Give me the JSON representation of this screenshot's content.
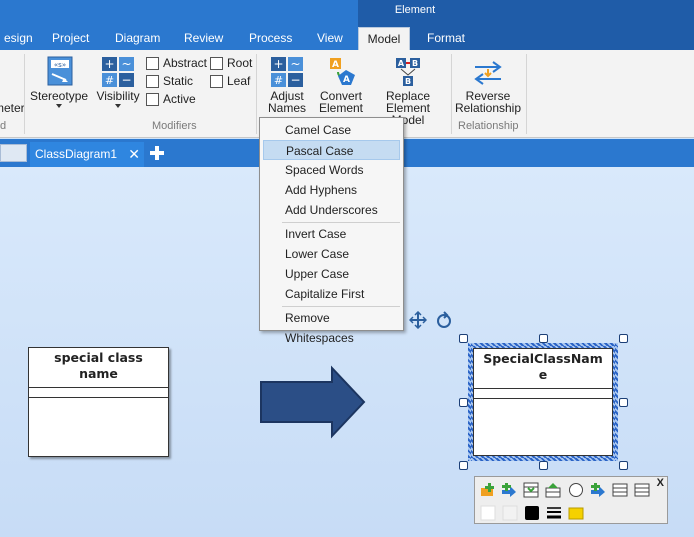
{
  "ribbon": {
    "context_title": "Element",
    "tabs": [
      {
        "label": "esign"
      },
      {
        "label": "Project"
      },
      {
        "label": "Diagram"
      },
      {
        "label": "Review"
      },
      {
        "label": "Process"
      },
      {
        "label": "View"
      },
      {
        "label": "Model"
      },
      {
        "label": "Format"
      }
    ],
    "active_tab": "Model",
    "left_cut_button": "meter",
    "left_cut_group": "d",
    "stereotype": {
      "label": "Stereotype"
    },
    "visibility": {
      "label": "Visibility"
    },
    "checkboxes": {
      "abstract": "Abstract",
      "static": "Static",
      "active": "Active",
      "root": "Root",
      "leaf": "Leaf"
    },
    "modifiers_group": "Modifiers",
    "adjust_names": {
      "line1": "Adjust",
      "line2": "Names"
    },
    "convert_element": {
      "line1": "Convert",
      "line2": "Element"
    },
    "replace_element": {
      "line1": "Replace",
      "line2": "Element Model"
    },
    "reverse_relationship": {
      "line1": "Reverse",
      "line2": "Relationship"
    },
    "relationship_group": "Relationship"
  },
  "doc_tabs": {
    "active": "ClassDiagram1",
    "close": "✕"
  },
  "menu": {
    "items_group1": [
      "Camel Case",
      "Pascal Case",
      "Spaced Words",
      "Add Hyphens",
      "Add Underscores"
    ],
    "items_group2": [
      "Invert Case",
      "Lower Case",
      "Upper Case",
      "Capitalize First"
    ],
    "items_group3": [
      "Remove Whitespaces"
    ],
    "highlighted": "Pascal Case"
  },
  "diagram": {
    "left_class": {
      "line1": "special class",
      "line2": "name"
    },
    "right_class": {
      "line1": "SpecialClassNam",
      "line2": "e"
    },
    "arrow_color": "#2b4e86"
  },
  "minibar": {
    "close": "X"
  },
  "colors": {
    "ribbon_blue": "#2b78cf",
    "element_band": "#1f5ca8",
    "menu_highlight": "#c5dcf2"
  }
}
